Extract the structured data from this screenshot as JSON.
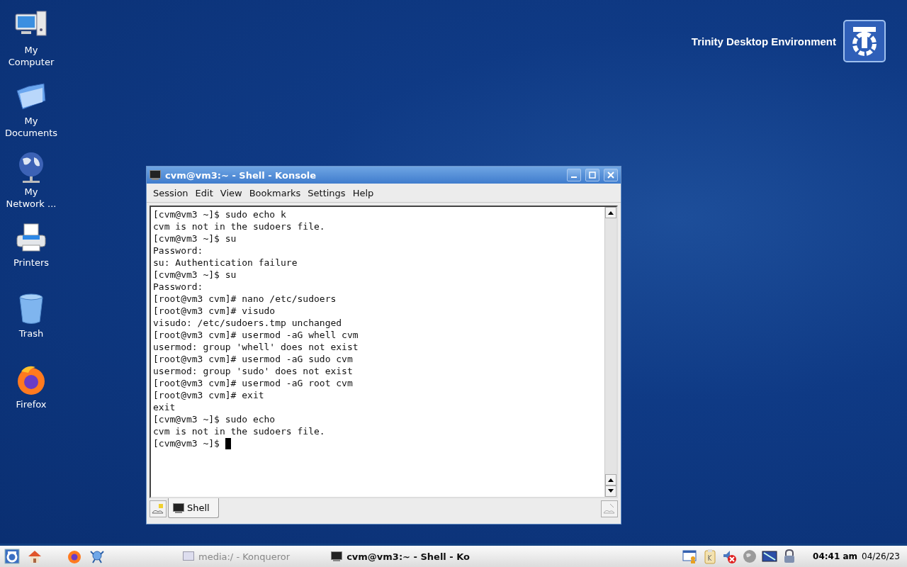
{
  "desktop_icons": [
    {
      "kind": "computer",
      "label": "My\nComputer"
    },
    {
      "kind": "documents",
      "label": "My\nDocuments"
    },
    {
      "kind": "network",
      "label": "My\nNetwork ..."
    },
    {
      "kind": "printer",
      "label": "Printers"
    },
    {
      "kind": "trash",
      "label": "Trash"
    },
    {
      "kind": "firefox",
      "label": "Firefox"
    }
  ],
  "branding": {
    "text": "Trinity Desktop Environment"
  },
  "window": {
    "title": "cvm@vm3:~ - Shell - Konsole",
    "menu": [
      "Session",
      "Edit",
      "View",
      "Bookmarks",
      "Settings",
      "Help"
    ],
    "terminal_lines": [
      "[cvm@vm3 ~]$ sudo echo k",
      "cvm is not in the sudoers file.",
      "[cvm@vm3 ~]$ su",
      "Password:",
      "su: Authentication failure",
      "[cvm@vm3 ~]$ su",
      "Password:",
      "[root@vm3 cvm]# nano /etc/sudoers",
      "[root@vm3 cvm]# visudo",
      "visudo: /etc/sudoers.tmp unchanged",
      "[root@vm3 cvm]# usermod -aG whell cvm",
      "usermod: group 'whell' does not exist",
      "[root@vm3 cvm]# usermod -aG sudo cvm",
      "usermod: group 'sudo' does not exist",
      "[root@vm3 cvm]# usermod -aG root cvm",
      "[root@vm3 cvm]# exit",
      "exit",
      "[cvm@vm3 ~]$ sudo echo",
      "cvm is not in the sudoers file.",
      "[cvm@vm3 ~]$ "
    ],
    "tabs": [
      {
        "label": "Shell",
        "selected": true
      }
    ]
  },
  "taskbar": {
    "launchers": [
      {
        "kind": "tde-menu"
      },
      {
        "kind": "home"
      },
      {
        "kind": "firefox"
      },
      {
        "kind": "network"
      }
    ],
    "tasks": [
      {
        "label": "media:/ - Konqueror",
        "selected": false
      },
      {
        "label": "cvm@vm3:~ - Shell - Ko",
        "selected": true
      }
    ],
    "tray": [
      {
        "kind": "window-user"
      },
      {
        "kind": "clipboard"
      },
      {
        "kind": "sound-muted"
      },
      {
        "kind": "globe"
      },
      {
        "kind": "display"
      },
      {
        "kind": "lock"
      }
    ],
    "time": "04:41 am",
    "date": "04/26/23"
  }
}
